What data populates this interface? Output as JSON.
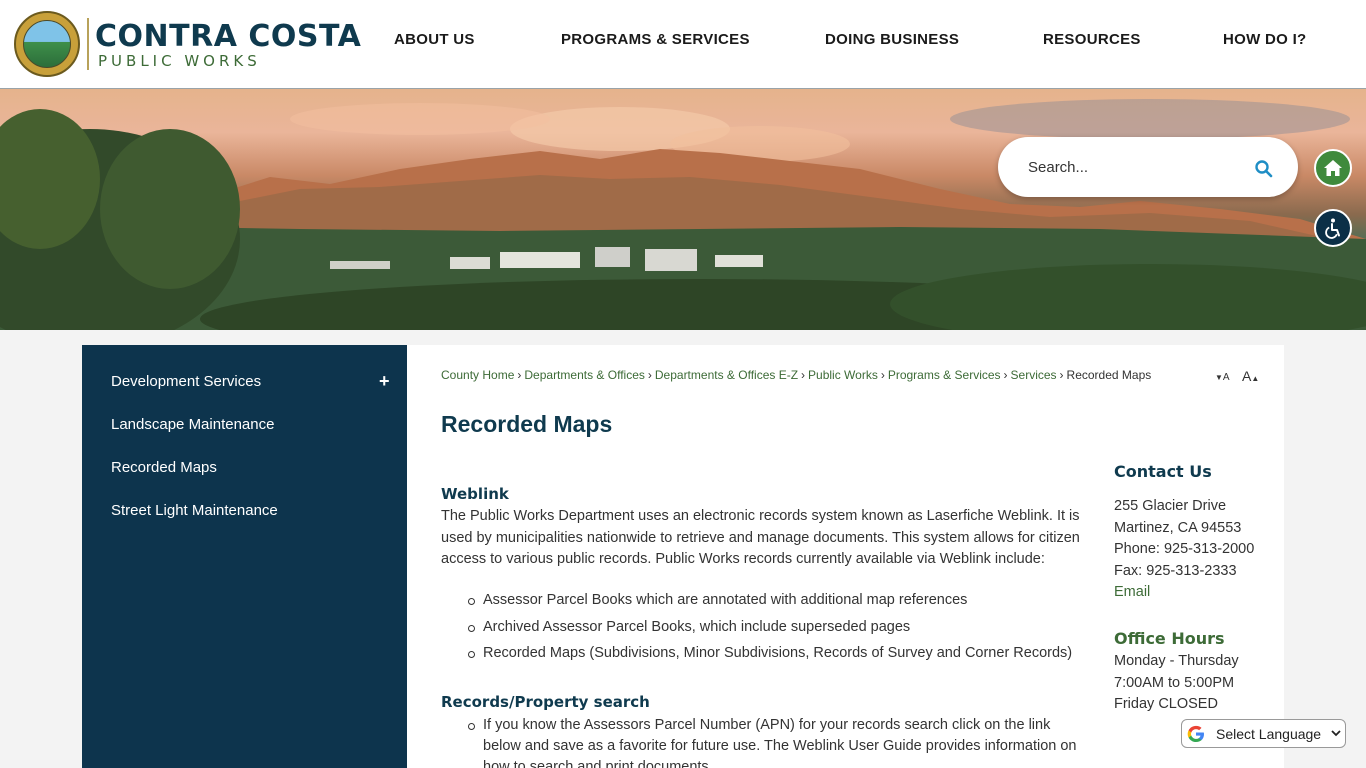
{
  "brand": {
    "title": "CONTRA COSTA",
    "subtitle": "PUBLIC WORKS"
  },
  "nav": [
    "ABOUT US",
    "PROGRAMS & SERVICES",
    "DOING BUSINESS",
    "RESOURCES",
    "HOW DO I?"
  ],
  "search": {
    "placeholder": "Search..."
  },
  "sidebar": {
    "items": [
      "Development Services",
      "Landscape Maintenance",
      "Recorded Maps",
      "Street Light Maintenance"
    ],
    "expand_symbol": "+"
  },
  "breadcrumb": {
    "links": [
      "County Home",
      "Departments & Offices",
      "Departments & Offices E-Z",
      "Public Works",
      "Programs & Services",
      "Services"
    ],
    "current": "Recorded Maps"
  },
  "font_controls": {
    "decrease": "A",
    "increase": "A"
  },
  "page_title": "Recorded Maps",
  "weblink": {
    "heading": "Weblink",
    "intro": "The Public Works Department uses an electronic records system known as Laserfiche Weblink. It is used by municipalities nationwide to retrieve and manage documents. This system allows for citizen access to various public records. Public Works records currently available via Weblink include:",
    "items": [
      "Assessor Parcel Books which are annotated with additional map references",
      "Archived Assessor Parcel Books, which include superseded pages",
      "Recorded Maps (Subdivisions, Minor Subdivisions, Records of Survey and Corner Records)"
    ]
  },
  "records_search": {
    "heading": "Records/Property search",
    "items": [
      "If you know the Assessors Parcel Number (APN) for your records search click on the link below and save as a favorite for future use. The Weblink User Guide provides information on how to search and print documents."
    ]
  },
  "contact": {
    "heading": "Contact Us",
    "address1": "255 Glacier Drive",
    "address2": "Martinez, CA 94553",
    "phone": "Phone: 925-313-2000",
    "fax": "Fax: 925-313-2333",
    "email": "Email"
  },
  "office_hours": {
    "heading": "Office Hours",
    "line1": "Monday - Thursday",
    "line2": "7:00AM to 5:00PM",
    "line3": "Friday CLOSED"
  },
  "translate": {
    "label": "Select Language"
  },
  "colors": {
    "navy": "#0d344d",
    "heading_navy": "#0f3a4e",
    "link_green": "#3d6b37",
    "home_green": "#3f8a3c"
  },
  "icons": [
    "search-icon",
    "home-icon",
    "accessibility-icon",
    "google-icon",
    "chevron-down-icon"
  ]
}
